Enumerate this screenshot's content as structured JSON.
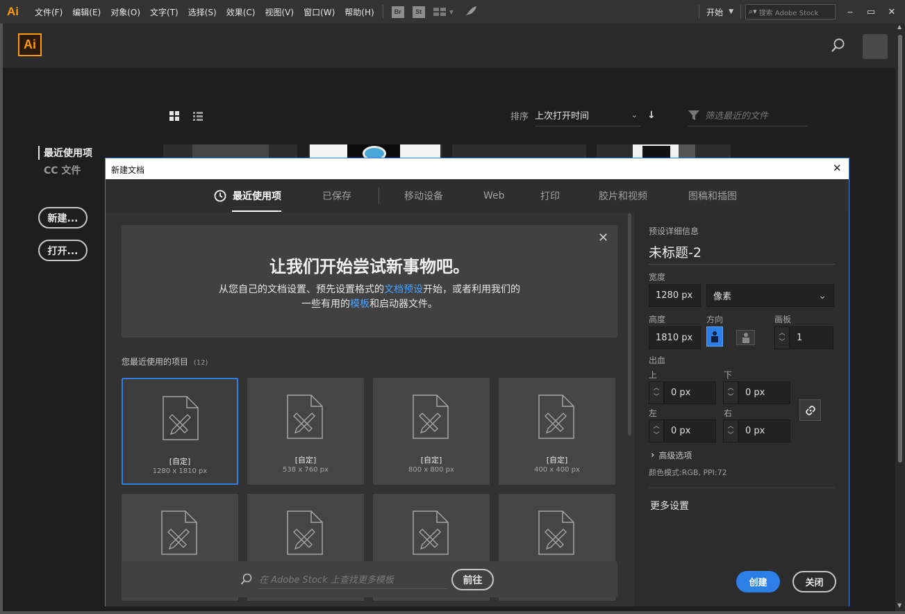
{
  "menubar": {
    "app_logo": "Ai",
    "menus": [
      "文件(F)",
      "编辑(E)",
      "对象(O)",
      "文字(T)",
      "选择(S)",
      "效果(C)",
      "视图(V)",
      "窗口(W)",
      "帮助(H)"
    ],
    "bridge_label": "Br",
    "stock_label": "St",
    "workspace_label": "开始",
    "search_placeholder": "搜索 Adobe Stock"
  },
  "home": {
    "app_logo": "Ai",
    "sort_label": "排序",
    "sort_value": "上次打开时间",
    "filter_placeholder": "筛选最近的文件",
    "nav": [
      "最近使用项",
      "CC 文件"
    ],
    "new_button": "新建...",
    "open_button": "打开..."
  },
  "dialog": {
    "title": "新建文档",
    "tabs": [
      "最近使用项",
      "已保存",
      "移动设备",
      "Web",
      "打印",
      "胶片和视频",
      "图稿和插图"
    ],
    "banner": {
      "heading": "让我们开始尝试新事物吧。",
      "line1_a": "从您自己的文档设置、预先设置格式的",
      "line1_link": "文档预设",
      "line1_b": "开始，或者利用我们的",
      "line2_a": "一些有用的",
      "line2_link": "模板",
      "line2_b": "和启动器文件。"
    },
    "recent_label": "您最近使用的项目",
    "recent_count": "(12)",
    "presets": [
      {
        "name": "[自定]",
        "size": "1280 x 1810 px"
      },
      {
        "name": "[自定]",
        "size": "538 x 760 px"
      },
      {
        "name": "[自定]",
        "size": "800 x 800 px"
      },
      {
        "name": "[自定]",
        "size": "400 x 400 px"
      }
    ],
    "stock_search_placeholder": "在 Adobe Stock 上查找更多模板",
    "go_button": "前往",
    "details": {
      "section_title": "预设详细信息",
      "doc_name": "未标题-2",
      "width_label": "宽度",
      "width_value": "1280 px",
      "unit_value": "像素",
      "height_label": "高度",
      "height_value": "1810 px",
      "orientation_label": "方向",
      "artboards_label": "画板",
      "artboards_value": "1",
      "bleed_label": "出血",
      "top_label": "上",
      "top_value": "0 px",
      "bottom_label": "下",
      "bottom_value": "0 px",
      "left_label": "左",
      "left_value": "0 px",
      "right_label": "右",
      "right_value": "0 px",
      "advanced_label": "高级选项",
      "color_mode": "颜色模式:RGB, PPI:72",
      "more_settings": "更多设置",
      "create_button": "创建",
      "close_button": "关闭"
    }
  },
  "colors": {
    "accent": "#2d7ee6",
    "brand": "#ff9a00",
    "link": "#4aa3ff"
  }
}
